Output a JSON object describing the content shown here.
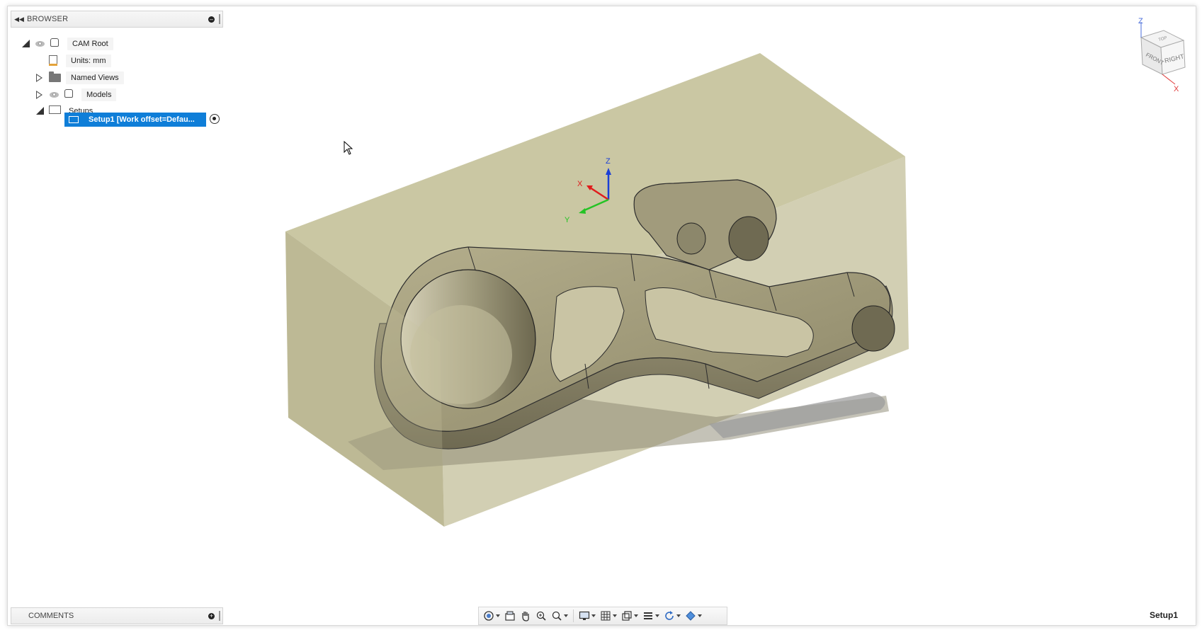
{
  "browser": {
    "title": "BROWSER",
    "tree": [
      {
        "label": "CAM Root"
      },
      {
        "label": "Units: mm"
      },
      {
        "label": "Named Views"
      },
      {
        "label": "Models"
      },
      {
        "label": "Setups"
      }
    ],
    "selected_setup": "Setup1 [Work offset=Defau..."
  },
  "viewport": {
    "axis_labels": {
      "x": "X",
      "y": "Y",
      "z": "Z"
    },
    "viewcube": {
      "front": "FRONT",
      "right": "RIGHT",
      "top": "TOP",
      "x": "X",
      "z": "Z"
    }
  },
  "comments": {
    "title": "COMMENTS"
  },
  "navbar": {
    "tools": [
      "orbit-icon",
      "look-at-icon",
      "pan-icon",
      "zoom-icon",
      "fit-icon",
      "display-settings-icon",
      "grid-icon",
      "viewports-icon",
      "environment-icon",
      "refresh-icon",
      "effects-icon"
    ]
  },
  "status": {
    "active_setup": "Setup1"
  },
  "colors": {
    "selection": "#0f7ed8",
    "stock": "#c9c69e",
    "part": "#8f8a70"
  }
}
